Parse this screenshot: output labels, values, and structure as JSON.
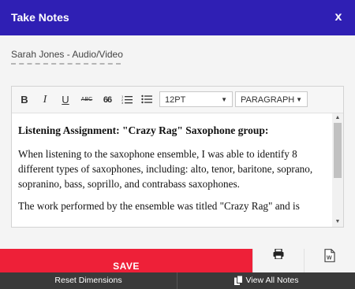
{
  "header": {
    "title": "Take Notes",
    "close_label": "x"
  },
  "subject": {
    "label": "Sarah Jones - Audio/Video"
  },
  "toolbar": {
    "bold": "B",
    "italic": "I",
    "underline": "U",
    "strike": "ABC",
    "quote": "66",
    "font_size": "12PT",
    "block_format": "PARAGRAPH"
  },
  "note": {
    "heading": "Listening Assignment: \"Crazy Rag\" Saxophone group:",
    "para1": "When listening to the saxophone ensemble, I was able to identify 8 different types of saxophones, including: alto, tenor, baritone, soprano, sopranino, bass, soprillo, and contrabass saxophones.",
    "para2": "The work performed by the ensemble was titled \"Crazy Rag\" and is"
  },
  "actions": {
    "save_label": "SAVE"
  },
  "footer": {
    "reset_label": "Reset Dimensions",
    "view_all_label": "View All Notes"
  },
  "colors": {
    "header": "#2f1fb4",
    "save": "#ee2038",
    "footer": "#3a3a3a"
  }
}
